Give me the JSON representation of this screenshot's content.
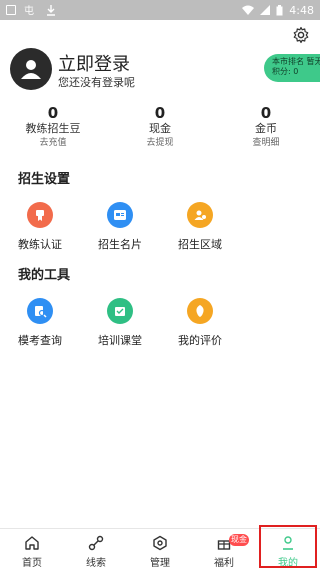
{
  "status_bar": {
    "left_icons": [
      "wechat-icon",
      "download-icon"
    ],
    "time": "4:48"
  },
  "profile": {
    "title": "立即登录",
    "subtitle": "您还没有登录呢",
    "rank_label": "本市排名",
    "rank_value": "暂无",
    "points_label": "积分",
    "points_value": "0"
  },
  "stats": [
    {
      "value": "0",
      "label": "教练招生豆",
      "action": "去充值"
    },
    {
      "value": "0",
      "label": "现金",
      "action": "去提现"
    },
    {
      "value": "0",
      "label": "金币",
      "action": "查明细"
    }
  ],
  "sections": {
    "recruit": {
      "title": "招生设置",
      "items": [
        {
          "label": "教练认证",
          "icon": "certificate-icon",
          "color": "#f26b4b"
        },
        {
          "label": "招生名片",
          "icon": "card-icon",
          "color": "#2f8ff3"
        },
        {
          "label": "招生区域",
          "icon": "area-icon",
          "color": "#f5a623"
        }
      ]
    },
    "tools": {
      "title": "我的工具",
      "items": [
        {
          "label": "模考查询",
          "icon": "exam-search-icon",
          "color": "#2f8ff3"
        },
        {
          "label": "培训课堂",
          "icon": "classroom-icon",
          "color": "#2fbf84"
        },
        {
          "label": "我的评价",
          "icon": "rating-icon",
          "color": "#f5a623"
        }
      ]
    }
  },
  "tabs": [
    {
      "label": "首页",
      "icon": "home-icon"
    },
    {
      "label": "线索",
      "icon": "clue-icon"
    },
    {
      "label": "管理",
      "icon": "manage-icon"
    },
    {
      "label": "福利",
      "icon": "gift-icon",
      "badge": "现金"
    },
    {
      "label": "我的",
      "icon": "person-icon",
      "active": true
    }
  ],
  "colors": {
    "accent": "#3ec98a",
    "highlight": "#e02020",
    "badge": "#ff4d4f"
  }
}
